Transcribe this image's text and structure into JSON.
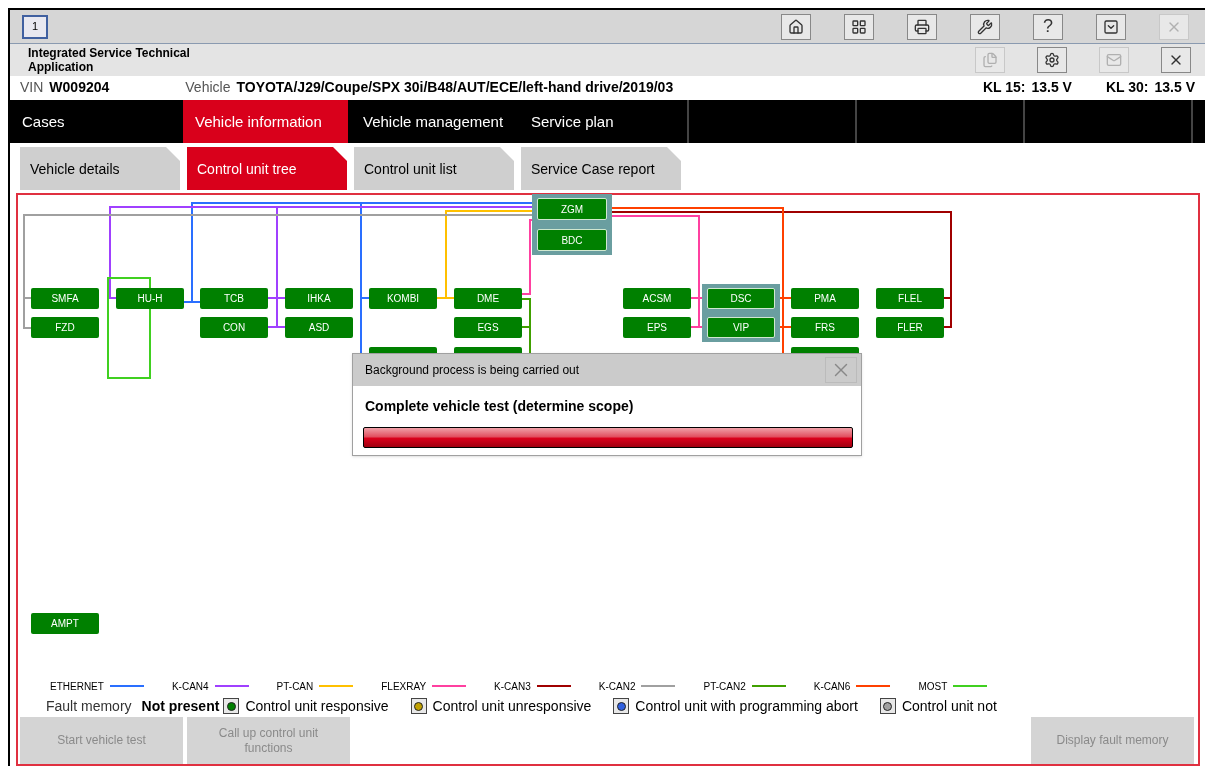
{
  "window_button": {
    "label": "1"
  },
  "toolbar": [
    {
      "kind": "icon",
      "disabled": false
    },
    {
      "kind": "icon",
      "disabled": false
    },
    {
      "kind": "icon",
      "disabled": false
    },
    {
      "kind": "icon",
      "disabled": false
    },
    {
      "kind": "text",
      "label": "?",
      "disabled": false
    },
    {
      "kind": "icon",
      "disabled": false
    },
    {
      "kind": "icon",
      "disabled": true
    }
  ],
  "app_title": "Integrated Service Technical Application",
  "app_toolbar": [
    {
      "kind": "icon",
      "disabled": true
    },
    {
      "kind": "icon",
      "disabled": false
    },
    {
      "kind": "icon",
      "disabled": true
    },
    {
      "kind": "icon",
      "disabled": false
    }
  ],
  "vehicle_bar": {
    "vin_label": "VIN",
    "vin": "W009204",
    "vehicle_label": "Vehicle",
    "vehicle": "TOYOTA/J29/Coupe/SPX 30i/B48/AUT/ECE/left-hand drive/2019/03",
    "kl15_label": "KL 15:",
    "kl15": "13.5 V",
    "kl30_label": "KL 30:",
    "kl30": "13.5 V"
  },
  "main_tabs": [
    {
      "label": "Cases",
      "selected": false
    },
    {
      "label": "Vehicle information",
      "selected": true
    },
    {
      "label": "Vehicle management",
      "selected": false
    },
    {
      "label": "Service plan",
      "selected": false
    }
  ],
  "sub_tabs": [
    {
      "label": "Vehicle details",
      "selected": false
    },
    {
      "label": "Control unit tree",
      "selected": true
    },
    {
      "label": "Control unit list",
      "selected": false
    },
    {
      "label": "Service Case report",
      "selected": false
    }
  ],
  "nodes": [
    {
      "kind": "unit",
      "label": "ZGM"
    },
    {
      "kind": "unit",
      "label": "BDC"
    },
    {
      "kind": "unit",
      "label": "SMFA"
    },
    {
      "kind": "unit",
      "label": "FZD"
    },
    {
      "kind": "unit",
      "label": "HU-H"
    },
    {
      "kind": "unit",
      "label": "TCB"
    },
    {
      "kind": "unit",
      "label": "CON"
    },
    {
      "kind": "unit",
      "label": "IHKA"
    },
    {
      "kind": "unit",
      "label": "ASD"
    },
    {
      "kind": "unit",
      "label": "KOMBI"
    },
    {
      "kind": "covered"
    },
    {
      "kind": "unit",
      "label": "DME"
    },
    {
      "kind": "unit",
      "label": "EGS"
    },
    {
      "kind": "covered"
    },
    {
      "kind": "unit",
      "label": "ACSM"
    },
    {
      "kind": "unit",
      "label": "EPS"
    },
    {
      "kind": "unit",
      "label": "DSC"
    },
    {
      "kind": "unit",
      "label": "VIP"
    },
    {
      "kind": "unit",
      "label": "PMA"
    },
    {
      "kind": "unit",
      "label": "FRS"
    },
    {
      "kind": "covered"
    },
    {
      "kind": "unit",
      "label": "FLEL"
    },
    {
      "kind": "unit",
      "label": "FLER"
    },
    {
      "kind": "unit",
      "label": "AMPT"
    }
  ],
  "dialog": {
    "title": "Background process is being carried out",
    "message": "Complete vehicle test (determine scope)"
  },
  "bus_legend": [
    {
      "label": "ETHERNET",
      "color": "#2a6fff"
    },
    {
      "label": "K-CAN4",
      "color": "#a040ff"
    },
    {
      "label": "PT-CAN",
      "color": "#ffc000"
    },
    {
      "label": "FLEXRAY",
      "color": "#ff40a0"
    },
    {
      "label": "K-CAN3",
      "color": "#a00000"
    },
    {
      "label": "K-CAN2",
      "color": "#a0a0a0"
    },
    {
      "label": "PT-CAN2",
      "color": "#40a000"
    },
    {
      "label": "K-CAN6",
      "color": "#ff4000"
    },
    {
      "label": "MOST",
      "color": "#40d020"
    }
  ],
  "fault_memory": {
    "label": "Fault memory",
    "value": "Not present"
  },
  "status_legend": [
    {
      "label": "Control unit responsive",
      "color": "#008000"
    },
    {
      "label": "Control unit unresponsive",
      "color": "#c0a000"
    },
    {
      "label": "Control unit with programming abort",
      "color": "#3060e0"
    },
    {
      "label": "Control unit not",
      "color": "#a0a0a0"
    }
  ],
  "buttons": [
    {
      "label": "Start vehicle test",
      "disabled": true
    },
    {
      "label": "Call up control unit functions",
      "disabled": true
    },
    {
      "label": "Display fault memory",
      "disabled": true
    }
  ]
}
